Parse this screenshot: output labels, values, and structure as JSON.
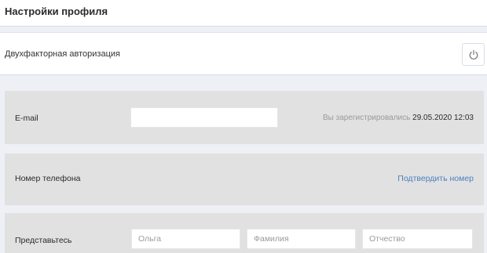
{
  "header": {
    "title": "Настройки профиля"
  },
  "two_factor": {
    "label": "Двухфакторная авторизация",
    "toggle_icon": "power-icon"
  },
  "email_row": {
    "label": "E-mail",
    "value": "",
    "registered_prefix": "Вы зарегистрировались",
    "registered_date": "29.05.2020 12:03"
  },
  "phone_row": {
    "label": "Номер телефона",
    "confirm_link": "Подтвердить номер"
  },
  "name_row": {
    "label": "Представьтесь",
    "first_name_placeholder": "Ольга",
    "last_name_placeholder": "Фамилия",
    "patronymic_placeholder": "Отчество"
  },
  "colors": {
    "link": "#4a7fc1",
    "row_background": "#e1e1e1",
    "page_background": "#eef0f6"
  }
}
